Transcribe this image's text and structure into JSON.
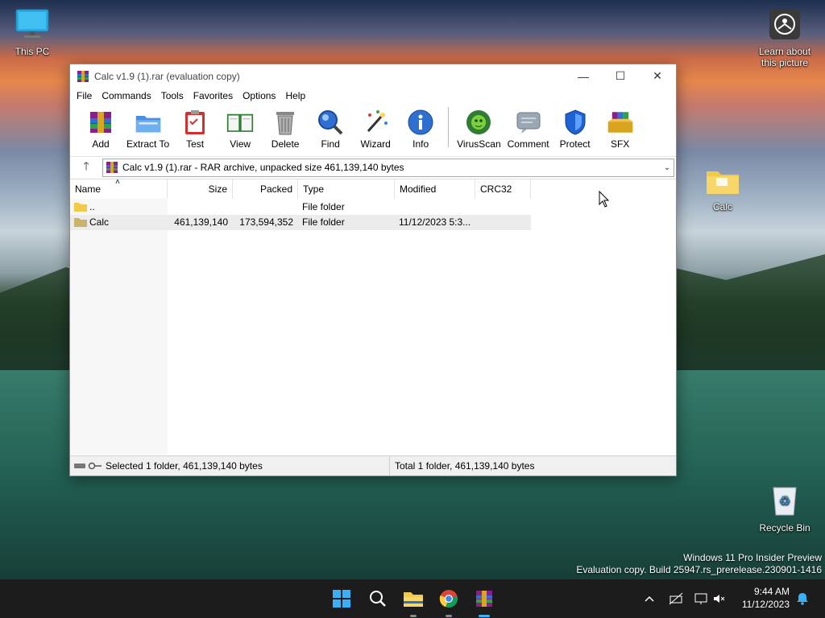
{
  "window": {
    "title": "Calc  v1.9 (1).rar (evaluation copy)",
    "minimize": "—",
    "maximize": "☐",
    "close": "✕"
  },
  "menu": [
    "File",
    "Commands",
    "Tools",
    "Favorites",
    "Options",
    "Help"
  ],
  "toolbar": [
    {
      "label": "Add",
      "icon": "add-archive-icon"
    },
    {
      "label": "Extract To",
      "icon": "extract-folder-icon"
    },
    {
      "label": "Test",
      "icon": "test-clipboard-icon"
    },
    {
      "label": "View",
      "icon": "book-icon"
    },
    {
      "label": "Delete",
      "icon": "trash-icon"
    },
    {
      "label": "Find",
      "icon": "magnifier-icon"
    },
    {
      "label": "Wizard",
      "icon": "wand-icon"
    },
    {
      "label": "Info",
      "icon": "info-icon"
    },
    {
      "label": "VirusScan",
      "icon": "virus-icon"
    },
    {
      "label": "Comment",
      "icon": "comment-icon"
    },
    {
      "label": "Protect",
      "icon": "shield-icon"
    },
    {
      "label": "SFX",
      "icon": "sfx-box-icon"
    }
  ],
  "address": {
    "text": "Calc  v1.9 (1).rar - RAR archive, unpacked size 461,139,140 bytes",
    "up": "🡑",
    "dropdown": "⌄"
  },
  "columns": {
    "name": "Name",
    "size": "Size",
    "packed": "Packed",
    "type": "Type",
    "modified": "Modified",
    "crc": "CRC32",
    "sort_arrow": "˄"
  },
  "rows": [
    {
      "name": "..",
      "size": "",
      "packed": "",
      "type": "File folder",
      "modified": "",
      "crc": ""
    },
    {
      "name": "Calc",
      "size": "461,139,140",
      "packed": "173,594,352",
      "type": "File folder",
      "modified": "11/12/2023 5:3...",
      "crc": ""
    }
  ],
  "status": {
    "left": "Selected 1 folder, 461,139,140 bytes",
    "right": "Total 1 folder, 461,139,140 bytes"
  },
  "desktop": {
    "this_pc": "This PC",
    "learn_line1": "Learn about",
    "learn_line2": "this picture",
    "calc_folder": "Calc",
    "recycle_bin": "Recycle Bin"
  },
  "watermark": {
    "line1": "Windows 11 Pro Insider Preview",
    "line2": "Evaluation copy. Build 25947.rs_prerelease.230901-1416"
  },
  "clock": {
    "time": "9:44 AM",
    "date": "11/12/2023"
  },
  "colors": {
    "taskbar": "#1c1c1c",
    "selection": "#ececec",
    "accent": "#0078d4"
  }
}
